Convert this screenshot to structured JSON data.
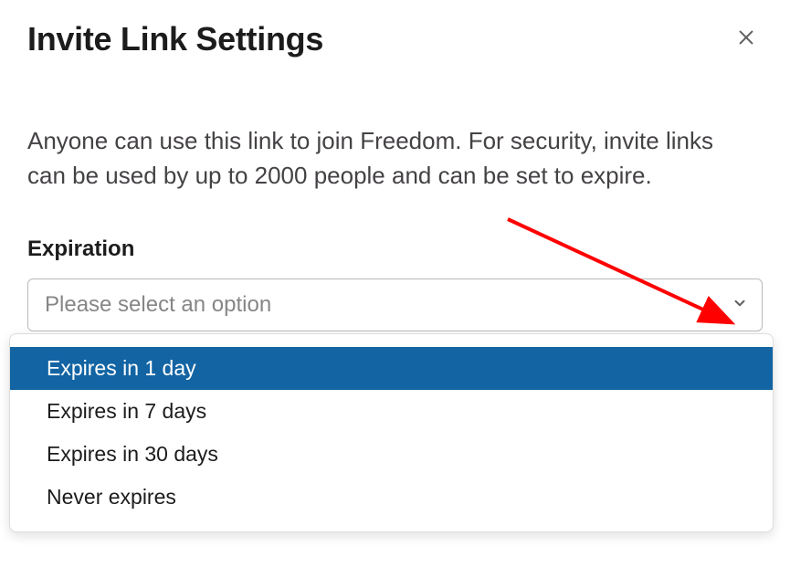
{
  "header": {
    "title": "Invite Link Settings"
  },
  "description": "Anyone can use this link to join Freedom. For security, invite links can be used by up to 2000 people and can be set to expire.",
  "field": {
    "label": "Expiration",
    "placeholder": "Please select an option"
  },
  "dropdown": {
    "options": [
      "Expires in 1 day",
      "Expires in 7 days",
      "Expires in 30 days",
      "Never expires"
    ],
    "highlighted_index": 0
  },
  "annotation": {
    "arrow_color": "#ff0000"
  }
}
